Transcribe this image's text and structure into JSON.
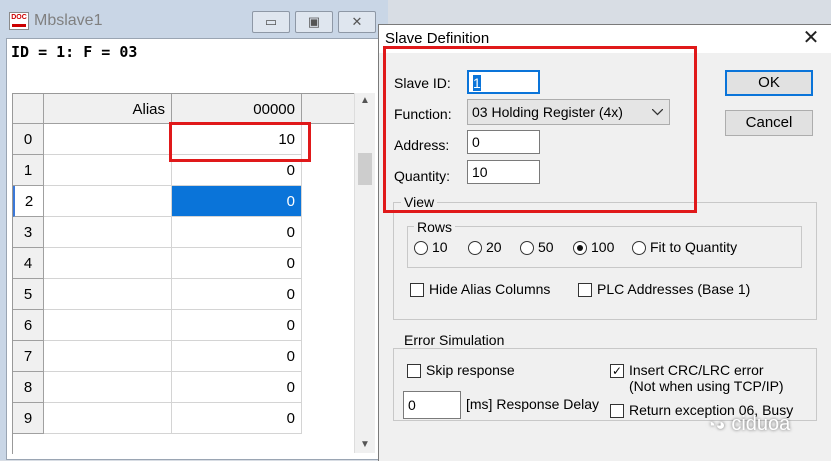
{
  "child_window": {
    "title": "Mbslave1",
    "minimize_glyph": "▭",
    "restore_glyph": "▣",
    "close_glyph": "✕",
    "status_line": "ID = 1: F = 03",
    "grid": {
      "headers": [
        "Alias",
        "00000"
      ],
      "rows": [
        {
          "index": "0",
          "value": "10"
        },
        {
          "index": "1",
          "value": "0"
        },
        {
          "index": "2",
          "value": "0"
        },
        {
          "index": "3",
          "value": "0"
        },
        {
          "index": "4",
          "value": "0"
        },
        {
          "index": "5",
          "value": "0"
        },
        {
          "index": "6",
          "value": "0"
        },
        {
          "index": "7",
          "value": "0"
        },
        {
          "index": "8",
          "value": "0"
        },
        {
          "index": "9",
          "value": "0"
        }
      ],
      "selected_row": "2"
    }
  },
  "dialog": {
    "title": "Slave Definition",
    "close_glyph": "✕",
    "slave_id_label": "Slave ID:",
    "slave_id_value": "1",
    "function_label": "Function:",
    "function_value": "03 Holding Register (4x)",
    "address_label": "Address:",
    "address_value": "0",
    "quantity_label": "Quantity:",
    "quantity_value": "10",
    "ok_label": "OK",
    "cancel_label": "Cancel",
    "view_label": "View",
    "rows_label": "Rows",
    "row_options": [
      "10",
      "20",
      "50",
      "100",
      "Fit to Quantity"
    ],
    "row_selected": "100",
    "hide_alias_label": "Hide Alias Columns",
    "plc_addresses_label": "PLC Addresses (Base 1)",
    "error_sim_label": "Error Simulation",
    "skip_response_label": "Skip response",
    "insert_crc_label": "Insert CRC/LRC error",
    "insert_crc_note": "(Not when using TCP/IP)",
    "response_delay_value": "0",
    "response_delay_label": "[ms] Response Delay",
    "return_exception_label": "Return exception 06, Busy",
    "insert_crc_checked": true
  },
  "watermark": "ciduoa",
  "colors": {
    "highlight_box": "#e0191a",
    "selection": "#0a74d9"
  }
}
